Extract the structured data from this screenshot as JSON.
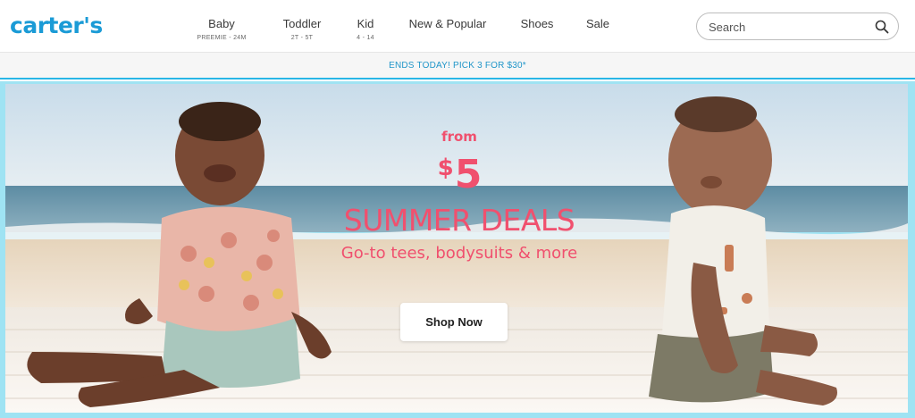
{
  "header": {
    "logo_text": "carter's",
    "nav": [
      {
        "label": "Baby",
        "sub": "PREEMIE - 24M"
      },
      {
        "label": "Toddler",
        "sub": "2T - 5T"
      },
      {
        "label": "Kid",
        "sub": "4 - 14"
      },
      {
        "label": "New & Popular",
        "sub": ""
      },
      {
        "label": "Shoes",
        "sub": ""
      },
      {
        "label": "Sale",
        "sub": ""
      }
    ],
    "search": {
      "placeholder": "Search",
      "icon": "search-icon"
    }
  },
  "promo_bar": {
    "text": "ENDS TODAY! PICK 3 FOR $30*"
  },
  "hero": {
    "from_text": "from",
    "price_symbol": "$",
    "price_value": "5",
    "headline": "SUMMER DEALS",
    "tagline": "Go-to tees, bodysuits & more",
    "cta_label": "Shop Now"
  },
  "colors": {
    "brand_blue": "#1b9bd6",
    "promo_text": "#2196c9",
    "hero_pink": "#f0506e",
    "hero_border": "#9fe3f3"
  }
}
